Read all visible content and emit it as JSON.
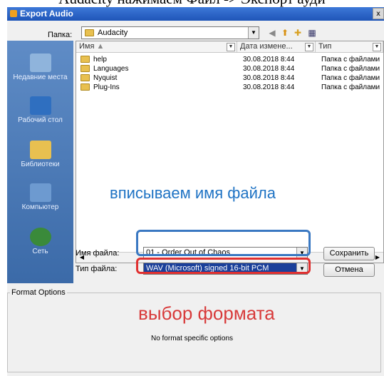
{
  "top_caption": "Audacity нажимаем Файл -> Экспорт ауди",
  "dialog": {
    "title": "Export Audio",
    "close_label": "x"
  },
  "lookin": {
    "label": "Папка:",
    "value": "Audacity"
  },
  "places": [
    {
      "label": "Недавние места",
      "icon": "recent-places-icon",
      "color": "#8fb4dc"
    },
    {
      "label": "Рабочий стол",
      "icon": "desktop-icon",
      "color": "#2f6fc0"
    },
    {
      "label": "Библиотеки",
      "icon": "libraries-icon",
      "color": "#e8c050"
    },
    {
      "label": "Компьютер",
      "icon": "computer-icon",
      "color": "#6d9ad0"
    },
    {
      "label": "Сеть",
      "icon": "network-icon",
      "color": "#3a8a3a"
    }
  ],
  "columns": [
    "Имя",
    "Дата измене...",
    "Тип"
  ],
  "files": [
    {
      "name": "help",
      "date": "30.08.2018 8:44",
      "type": "Папка с файлами"
    },
    {
      "name": "Languages",
      "date": "30.08.2018 8:44",
      "type": "Папка с файлами"
    },
    {
      "name": "Nyquist",
      "date": "30.08.2018 8:44",
      "type": "Папка с файлами"
    },
    {
      "name": "Plug-Ins",
      "date": "30.08.2018 8:44",
      "type": "Папка с файлами"
    }
  ],
  "filename": {
    "label": "Имя файла:",
    "value": "01 - Order Out of Chaos"
  },
  "filetype": {
    "label": "Тип файла:",
    "value": "WAV (Microsoft) signed 16-bit PCM"
  },
  "buttons": {
    "save": "Сохранить",
    "cancel": "Отмена"
  },
  "format_options": {
    "legend": "Format Options",
    "message": "No format specific options"
  },
  "annotations": {
    "filename_hint": "вписываем имя файла",
    "format_hint": "выбор формата"
  },
  "colors": {
    "annotation_blue": "#1f73c4",
    "annotation_red": "#d83a3a",
    "selection": "#1a3f9a"
  }
}
